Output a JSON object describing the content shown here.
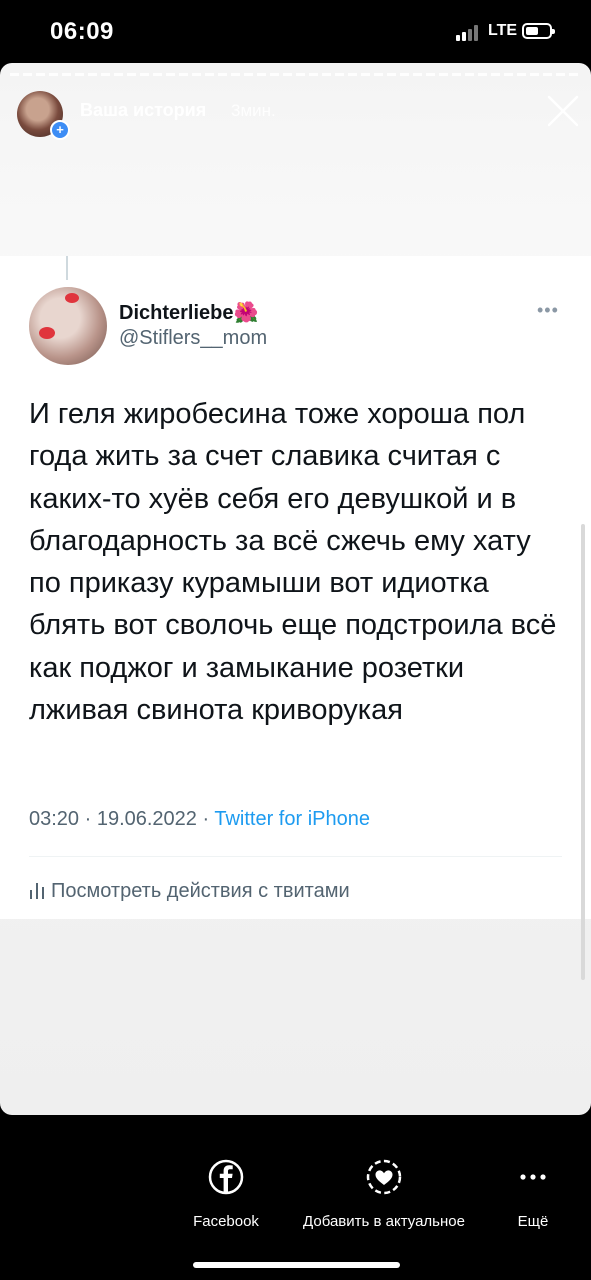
{
  "status_bar": {
    "time": "06:09",
    "network": "LTE"
  },
  "story_header": {
    "name": "Ваша история",
    "time_ago": "3мин."
  },
  "tweet": {
    "display_name": "Dichterliebe",
    "flower_emoji": "🌺",
    "handle": "@Stiflers__mom",
    "text": "И геля жиробесина тоже хороша пол года жить за счет славика считая с каких-то хуёв себя его девушкой и в благодарность за всё сжечь ему хату по приказу курамыши вот идиотка блять вот сволочь еще подстроила всё как поджог и замыкание розетки лживая свинота криворукая",
    "timestamp": "03:20 · 19.06.2022 · ",
    "source": "Twitter for iPhone",
    "analytics_label": "Посмотреть действия с твитами"
  },
  "bottom_actions": {
    "facebook": "Facebook",
    "highlight": "Добавить в актуальное",
    "more": "Ещё"
  },
  "colors": {
    "accent": "#1d9bf0",
    "plus_badge": "#3d8df5"
  }
}
